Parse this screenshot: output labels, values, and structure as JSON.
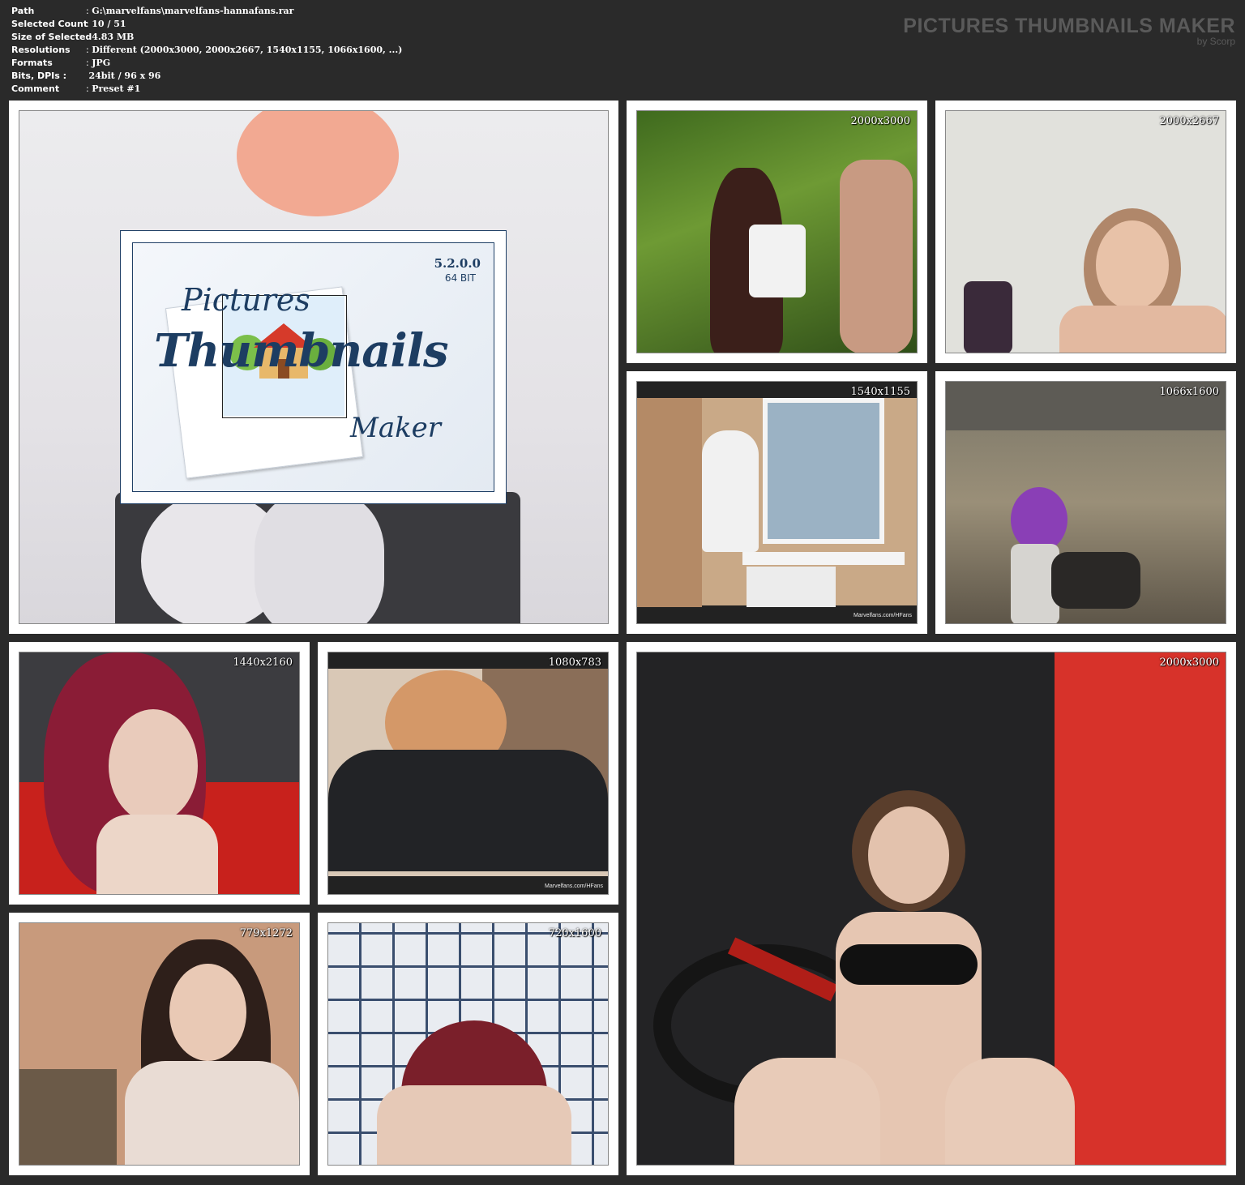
{
  "info": {
    "path_key": "Path",
    "path_val": "G:\\marvelfans\\marvelfans-hannafans.rar",
    "count_key": "Selected Count",
    "count_val": "10 / 51",
    "size_key": "Size of Selected",
    "size_val": "4.83 MB",
    "res_key": "Resolutions",
    "res_val": "Different (2000x3000, 2000x2667, 1540x1155, 1066x1600, ...)",
    "formats_key": "Formats",
    "formats_val": "JPG",
    "bits_key": "Bits, DPIs :",
    "bits_val": "24bit / 96 x 96",
    "comment_key": "Comment",
    "comment_val": "Preset #1",
    "sep": ":"
  },
  "brand": {
    "title": "PICTURES THUMBNAILS MAKER",
    "subtitle": "by Scorp"
  },
  "logo": {
    "version": "5.2.0.0",
    "bits": "64 BIT",
    "word1": "Pictures",
    "word2": "Thumbnails",
    "word3": "Maker"
  },
  "thumbs": [
    {
      "resolution": "2000x3000"
    },
    {
      "resolution": "2000x2667"
    },
    {
      "resolution": "1540x1155",
      "watermark": "Marvelfans.com/HFans"
    },
    {
      "resolution": "1066x1600"
    },
    {
      "resolution": "1440x2160"
    },
    {
      "resolution": "1080x783",
      "watermark": "Marvelfans.com/HFans"
    },
    {
      "resolution": "2000x3000"
    },
    {
      "resolution": "779x1272"
    },
    {
      "resolution": "720x1600"
    }
  ]
}
